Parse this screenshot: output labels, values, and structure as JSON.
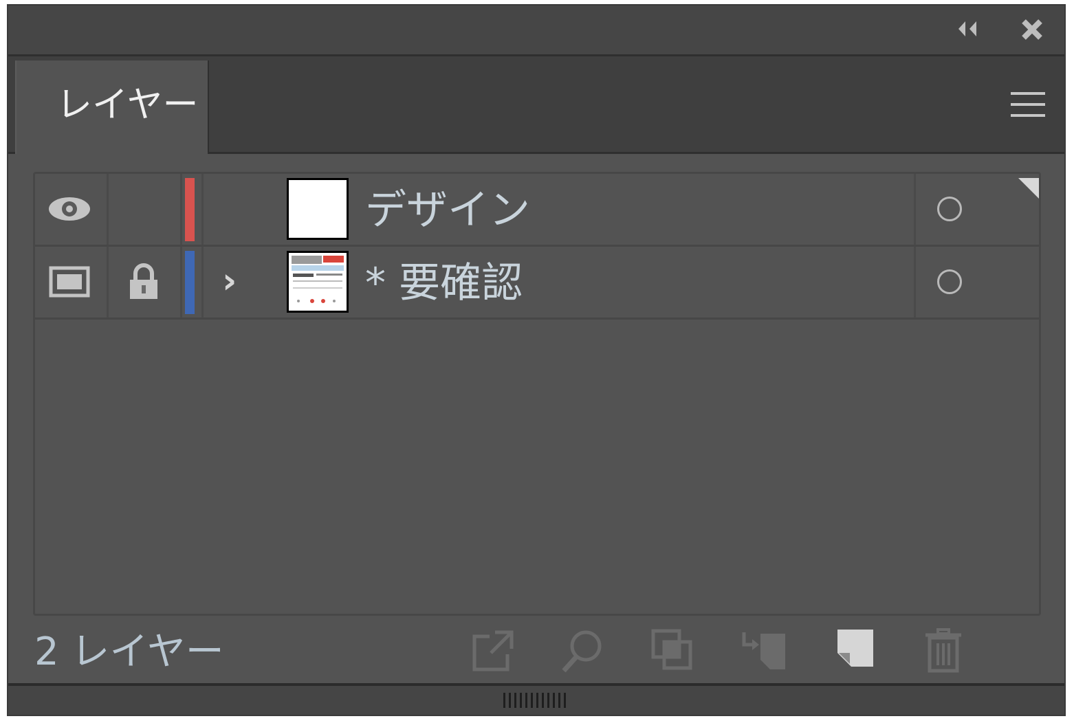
{
  "titlebar": {
    "collapse_icon": "double-chevron-left-icon",
    "close_icon": "close-icon"
  },
  "tab": {
    "label": "レイヤー",
    "menu_icon": "hamburger-menu-icon"
  },
  "layers": [
    {
      "name": "デザイン",
      "visible_icon": "eye-icon",
      "locked": false,
      "expandable": false,
      "color": "#d9534f",
      "thumbnail": "blank-white"
    },
    {
      "name": "* 要確認",
      "visible_icon": "template-icon",
      "locked": true,
      "lock_icon": "lock-icon",
      "expandable": true,
      "expand_icon": "chevron-right-icon",
      "color": "#3f68b5",
      "thumbnail": "document-preview"
    }
  ],
  "footer": {
    "count_label": "2 レイヤー",
    "buttons": [
      {
        "name": "export-button",
        "icon": "export-icon"
      },
      {
        "name": "locate-object-button",
        "icon": "magnifier-icon"
      },
      {
        "name": "make-clipping-mask-button",
        "icon": "clipping-mask-icon"
      },
      {
        "name": "create-sublayer-button",
        "icon": "new-sublayer-icon"
      },
      {
        "name": "create-layer-button",
        "icon": "new-layer-icon"
      },
      {
        "name": "delete-button",
        "icon": "trash-icon"
      }
    ]
  },
  "colors": {
    "panel_bg": "#535353",
    "titlebar_bg": "#464646",
    "tabbar_bg": "#3f3f3f",
    "text_light": "#c9d4dc"
  }
}
